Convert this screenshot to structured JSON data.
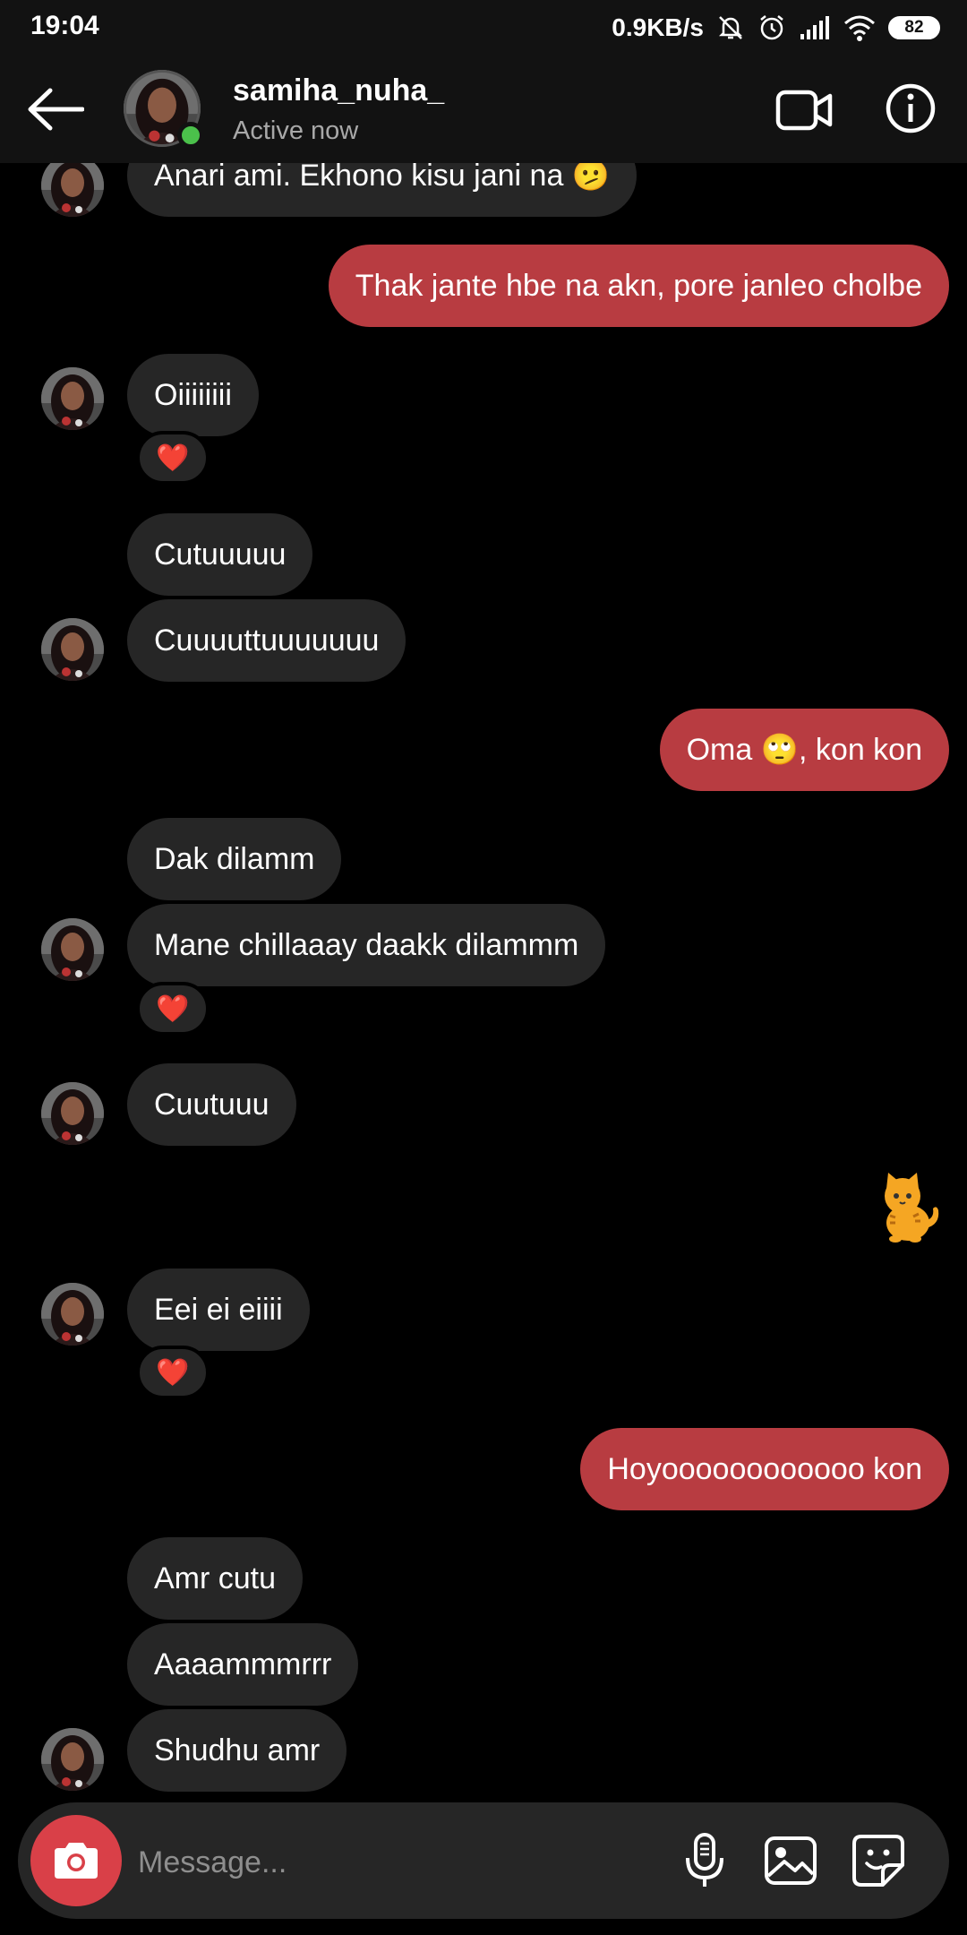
{
  "status_bar": {
    "time": "19:04",
    "speed": "0.9KB/s",
    "battery": "82"
  },
  "header": {
    "username": "samiha_nuha_",
    "activity": "Active now"
  },
  "messages": [
    {
      "text": "Anari ami. Ekhono kisu jani na 🫤"
    },
    {
      "text": "Thak jante hbe na akn, pore janleo cholbe"
    },
    {
      "text": "Oiiiiiiii"
    },
    {
      "text": "Cutuuuuu"
    },
    {
      "text": "Cuuuuttuuuuuuu"
    },
    {
      "text": "Oma 🙄, kon kon"
    },
    {
      "text": "Dak dilamm"
    },
    {
      "text": "Mane chillaaay daakk dilammm"
    },
    {
      "text": "Cuutuuu"
    },
    {
      "text": "Eei ei eiiii"
    },
    {
      "text": "Hoyoooooooooooo kon"
    },
    {
      "text": "Amr cutu"
    },
    {
      "text": "Aaaammmrrr"
    },
    {
      "text": "Shudhu amr"
    }
  ],
  "reaction_emoji": "❤️",
  "composer": {
    "placeholder": "Message..."
  },
  "icons": [
    "back-arrow-icon",
    "video-call-icon",
    "info-icon",
    "camera-icon",
    "microphone-icon",
    "gallery-icon",
    "sticker-icon"
  ],
  "colors": {
    "background": "#000000",
    "incoming_bubble": "#262626",
    "outgoing_bubble": "#b83c41",
    "camera_button": "#d94048",
    "online_dot": "#4bc14b"
  }
}
